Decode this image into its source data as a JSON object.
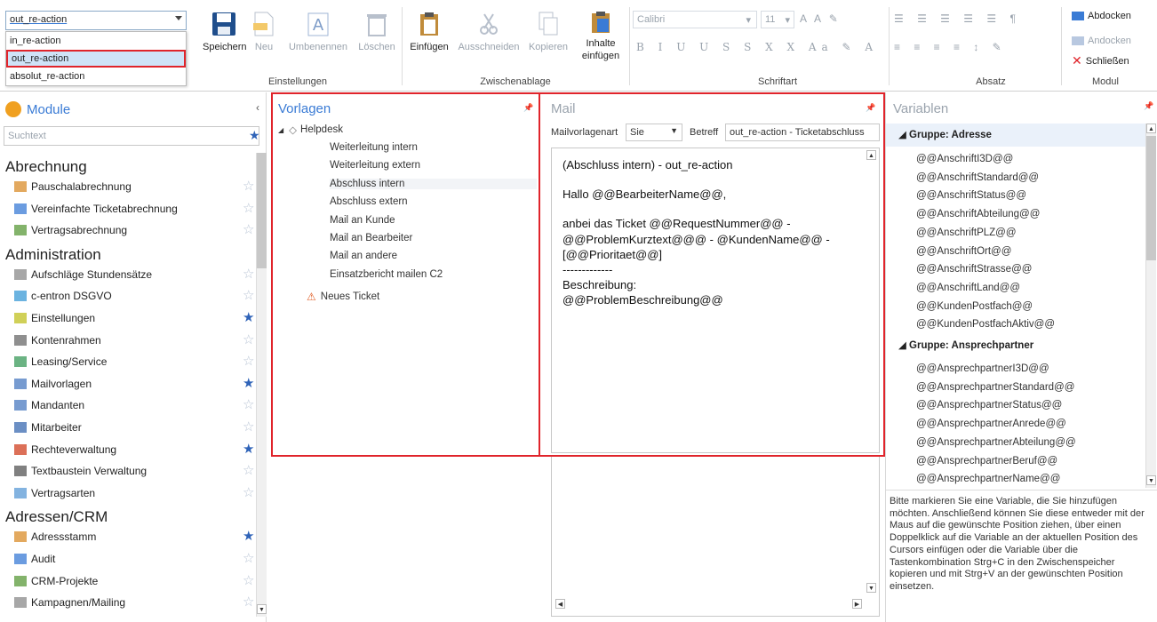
{
  "ribbon": {
    "combo_value": "out_re-action",
    "combo_options": [
      "in_re-action",
      "out_re-action",
      "absolut_re-action"
    ],
    "buttons": {
      "speichern": "Speichern",
      "neu": "Neu",
      "umbenennen": "Umbenennen",
      "loeschen": "Löschen",
      "einfuegen": "Einfügen",
      "ausschneiden": "Ausschneiden",
      "kopieren": "Kopieren",
      "inhalte_einfuegen_1": "Inhalte",
      "inhalte_einfuegen_2": "einfügen",
      "abdocken": "Abdocken",
      "andocken": "Andocken",
      "schliessen": "Schließen"
    },
    "groups": {
      "einstellungen": "Einstellungen",
      "zwischenablage": "Zwischenablage",
      "schriftart": "Schriftart",
      "absatz": "Absatz",
      "modul": "Modul"
    },
    "font_name": "Calibri",
    "font_size": "11"
  },
  "left": {
    "title": "Module",
    "search_placeholder": "Suchtext",
    "categories": [
      {
        "name": "Abrechnung",
        "items": [
          {
            "label": "Pauschalabrechnung",
            "fav": false
          },
          {
            "label": "Vereinfachte Ticketabrechnung",
            "fav": false
          },
          {
            "label": "Vertragsabrechnung",
            "fav": false
          }
        ]
      },
      {
        "name": "Administration",
        "items": [
          {
            "label": "Aufschläge Stundensätze",
            "fav": false
          },
          {
            "label": "c-entron DSGVO",
            "fav": false
          },
          {
            "label": "Einstellungen",
            "fav": true
          },
          {
            "label": "Kontenrahmen",
            "fav": false
          },
          {
            "label": "Leasing/Service",
            "fav": false
          },
          {
            "label": "Mailvorlagen",
            "fav": true
          },
          {
            "label": "Mandanten",
            "fav": false
          },
          {
            "label": "Mitarbeiter",
            "fav": false
          },
          {
            "label": "Rechteverwaltung",
            "fav": true
          },
          {
            "label": "Textbaustein Verwaltung",
            "fav": false
          },
          {
            "label": "Vertragsarten",
            "fav": false
          }
        ]
      },
      {
        "name": "Adressen/CRM",
        "items": [
          {
            "label": "Adressstamm",
            "fav": true
          },
          {
            "label": "Audit",
            "fav": false
          },
          {
            "label": "CRM-Projekte",
            "fav": false
          },
          {
            "label": "Kampagnen/Mailing",
            "fav": false
          }
        ]
      }
    ]
  },
  "vorlagen": {
    "title": "Vorlagen",
    "root": "Helpdesk",
    "items": [
      "Weiterleitung intern",
      "Weiterleitung extern",
      "Abschluss intern",
      "Abschluss extern",
      "Mail an Kunde",
      "Mail an Bearbeiter",
      "Mail an andere",
      "Einsatzbericht mailen C2"
    ],
    "neues_ticket": "Neues Ticket"
  },
  "mail": {
    "title": "Mail",
    "mailvorlagenart_label": "Mailvorlagenart",
    "mailvorlagenart_value": "Sie",
    "betreff_label": "Betreff",
    "betreff_value": "out_re-action - Ticketabschluss",
    "body": [
      "(Abschluss intern) - out_re-action",
      "",
      "Hallo @@BearbeiterName@@,",
      "",
      "anbei das Ticket @@RequestNummer@@ -",
      "@@ProblemKurztext@@@ - @KundenName@@ -",
      "[@@Prioritaet@@]",
      "-------------",
      "Beschreibung:",
      "@@ProblemBeschreibung@@"
    ]
  },
  "variablen": {
    "title": "Variablen",
    "group1": "Gruppe: Adresse",
    "group1_items": [
      "@@AnschriftI3D@@",
      "@@AnschriftStandard@@",
      "@@AnschriftStatus@@",
      "@@AnschriftAbteilung@@",
      "@@AnschriftPLZ@@",
      "@@AnschriftOrt@@",
      "@@AnschriftStrasse@@",
      "@@AnschriftLand@@",
      "@@KundenPostfach@@",
      "@@KundenPostfachAktiv@@"
    ],
    "group2": "Gruppe: Ansprechpartner",
    "group2_items": [
      "@@AnsprechpartnerI3D@@",
      "@@AnsprechpartnerStandard@@",
      "@@AnsprechpartnerStatus@@",
      "@@AnsprechpartnerAnrede@@",
      "@@AnsprechpartnerAbteilung@@",
      "@@AnsprechpartnerBeruf@@",
      "@@AnsprechpartnerName@@"
    ],
    "hint": "Bitte markieren Sie eine Variable, die Sie hinzufügen möchten. Anschließend können Sie diese entweder mit der Maus auf die gewünschte Position ziehen, über einen Doppelklick auf die Variable an der aktuellen Position des Cursors einfügen oder die Variable über die Tastenkombination Strg+C in den Zwischenspeicher kopieren und mit Strg+V an der gewünschten Position einsetzen."
  },
  "colors": {
    "accent": "#3a7bd5",
    "highlight": "#e0242b",
    "fav_star": "#2f63b8"
  }
}
